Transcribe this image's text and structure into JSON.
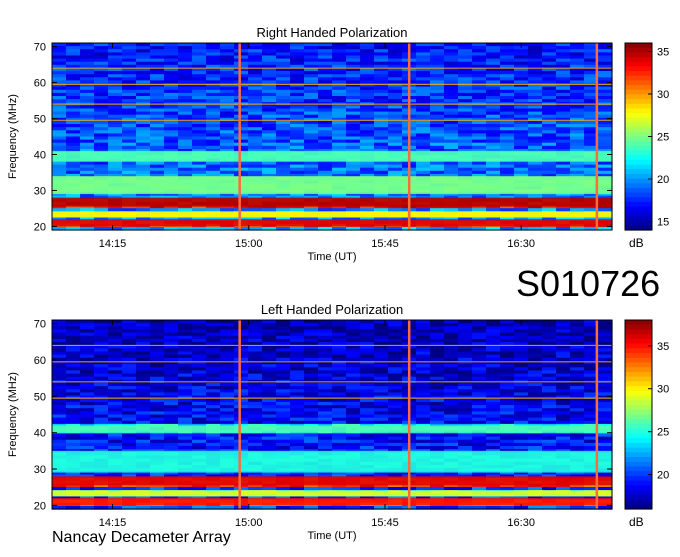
{
  "observation_id": "S010726",
  "instrument": "Nancay Decameter Array",
  "chart_data": [
    {
      "type": "heatmap",
      "title": "Right Handed Polarization",
      "xlabel": "Time (UT)",
      "ylabel": "Frequency (MHz)",
      "x_ticks": [
        "14:15",
        "15:00",
        "15:45",
        "16:30"
      ],
      "y_ticks": [
        20,
        30,
        40,
        50,
        60,
        70
      ],
      "ylim": [
        19,
        71
      ],
      "colorbar": {
        "label": "dB",
        "ticks": [
          15,
          20,
          25,
          30,
          35
        ],
        "range": [
          14,
          36
        ]
      },
      "vertical_markers": [
        "14:57",
        "15:53",
        "16:55"
      ],
      "emission_bands_mhz": [
        {
          "from": 25.5,
          "to": 28,
          "level_db": 35
        },
        {
          "from": 20,
          "to": 22,
          "level_db": 34
        },
        {
          "from": 22.5,
          "to": 24,
          "level_db": 28
        },
        {
          "from": 29,
          "to": 34,
          "level_db": 25
        },
        {
          "from": 38,
          "to": 41,
          "level_db": 24
        }
      ]
    },
    {
      "type": "heatmap",
      "title": "Left Handed Polarization",
      "xlabel": "Time (UT)",
      "ylabel": "Frequency (MHz)",
      "x_ticks": [
        "14:15",
        "15:00",
        "15:45",
        "16:30"
      ],
      "y_ticks": [
        20,
        30,
        40,
        50,
        60,
        70
      ],
      "ylim": [
        19,
        71
      ],
      "colorbar": {
        "label": "dB",
        "ticks": [
          20,
          25,
          30,
          35
        ],
        "range": [
          16,
          38
        ]
      },
      "vertical_markers": [
        "14:57",
        "15:53",
        "16:55"
      ],
      "emission_bands_mhz": [
        {
          "from": 25.5,
          "to": 28,
          "level_db": 36
        },
        {
          "from": 20,
          "to": 22,
          "level_db": 35
        },
        {
          "from": 22.5,
          "to": 24,
          "level_db": 29
        },
        {
          "from": 29,
          "to": 35,
          "level_db": 25
        },
        {
          "from": 40,
          "to": 42,
          "level_db": 26
        }
      ]
    }
  ]
}
